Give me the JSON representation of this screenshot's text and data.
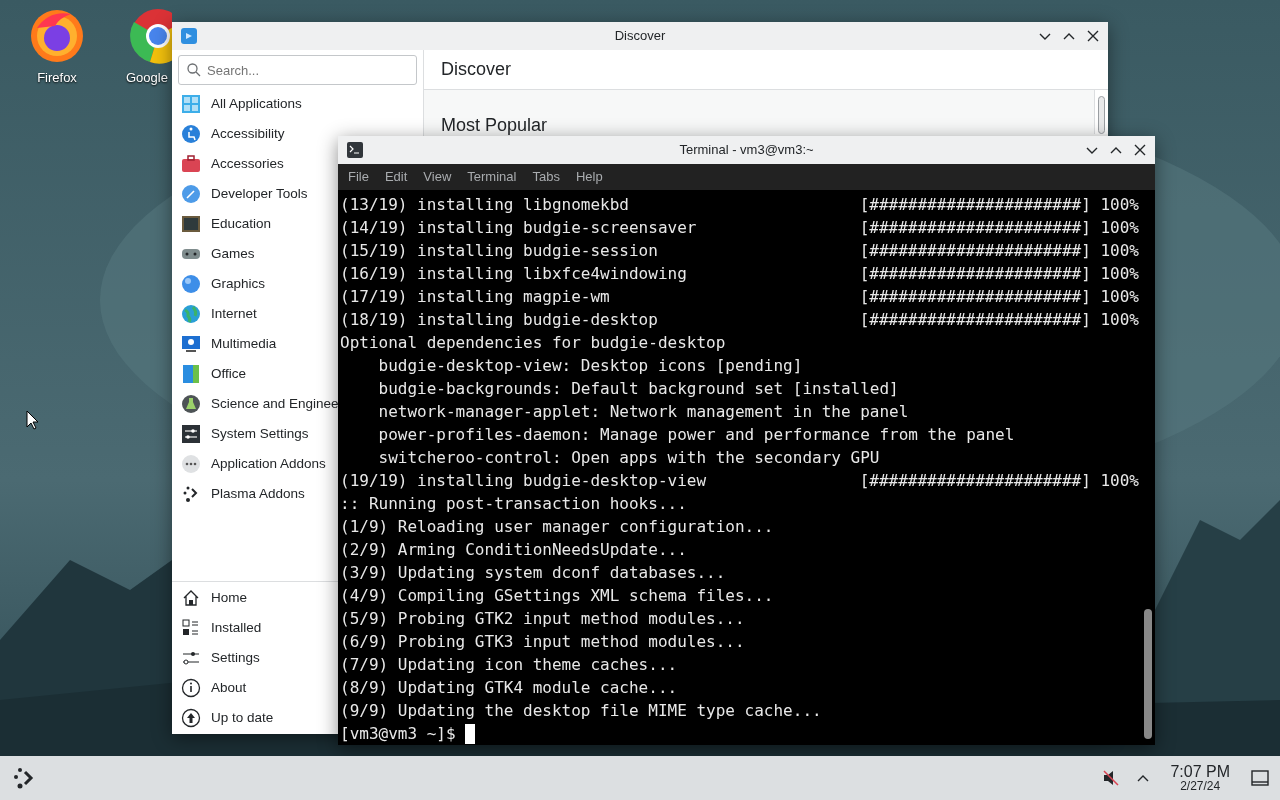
{
  "desktop": {
    "icons": [
      {
        "label": "Firefox"
      },
      {
        "label": "Google"
      }
    ]
  },
  "discover": {
    "title": "Discover",
    "search": {
      "placeholder": "Search..."
    },
    "categories": [
      {
        "label": "All Applications"
      },
      {
        "label": "Accessibility"
      },
      {
        "label": "Accessories"
      },
      {
        "label": "Developer Tools"
      },
      {
        "label": "Education"
      },
      {
        "label": "Games"
      },
      {
        "label": "Graphics"
      },
      {
        "label": "Internet"
      },
      {
        "label": "Multimedia"
      },
      {
        "label": "Office"
      },
      {
        "label": "Science and Enginee"
      },
      {
        "label": "System Settings"
      },
      {
        "label": "Application Addons"
      },
      {
        "label": "Plasma Addons"
      }
    ],
    "nav": [
      {
        "label": "Home"
      },
      {
        "label": "Installed"
      },
      {
        "label": "Settings"
      },
      {
        "label": "About"
      },
      {
        "label": "Up to date"
      }
    ],
    "page_title": "Discover",
    "section_title": "Most Popular"
  },
  "terminal": {
    "title": "Terminal - vm3@vm3:~",
    "menu": [
      "File",
      "Edit",
      "View",
      "Terminal",
      "Tabs",
      "Help"
    ],
    "lines": [
      {
        "text": "(13/19) installing libgnomekbd",
        "status": "[######################] 100%"
      },
      {
        "text": "(14/19) installing budgie-screensaver",
        "status": "[######################] 100%"
      },
      {
        "text": "(15/19) installing budgie-session",
        "status": "[######################] 100%"
      },
      {
        "text": "(16/19) installing libxfce4windowing",
        "status": "[######################] 100%"
      },
      {
        "text": "(17/19) installing magpie-wm",
        "status": "[######################] 100%"
      },
      {
        "text": "(18/19) installing budgie-desktop",
        "status": "[######################] 100%"
      },
      {
        "text": "Optional dependencies for budgie-desktop"
      },
      {
        "text": "    budgie-desktop-view: Desktop icons [pending]"
      },
      {
        "text": "    budgie-backgrounds: Default background set [installed]"
      },
      {
        "text": "    network-manager-applet: Network management in the panel"
      },
      {
        "text": "    power-profiles-daemon: Manage power and performance from the panel"
      },
      {
        "text": "    switcheroo-control: Open apps with the secondary GPU"
      },
      {
        "text": "(19/19) installing budgie-desktop-view",
        "status": "[######################] 100%"
      },
      {
        "text": ":: Running post-transaction hooks..."
      },
      {
        "text": "(1/9) Reloading user manager configuration..."
      },
      {
        "text": "(2/9) Arming ConditionNeedsUpdate..."
      },
      {
        "text": "(3/9) Updating system dconf databases..."
      },
      {
        "text": "(4/9) Compiling GSettings XML schema files..."
      },
      {
        "text": "(5/9) Probing GTK2 input method modules..."
      },
      {
        "text": "(6/9) Probing GTK3 input method modules..."
      },
      {
        "text": "(7/9) Updating icon theme caches..."
      },
      {
        "text": "(8/9) Updating GTK4 module cache..."
      },
      {
        "text": "(9/9) Updating the desktop file MIME type cache..."
      }
    ],
    "prompt": "[vm3@vm3 ~]$"
  },
  "taskbar": {
    "time": "7:07 PM",
    "date": "2/27/24"
  }
}
